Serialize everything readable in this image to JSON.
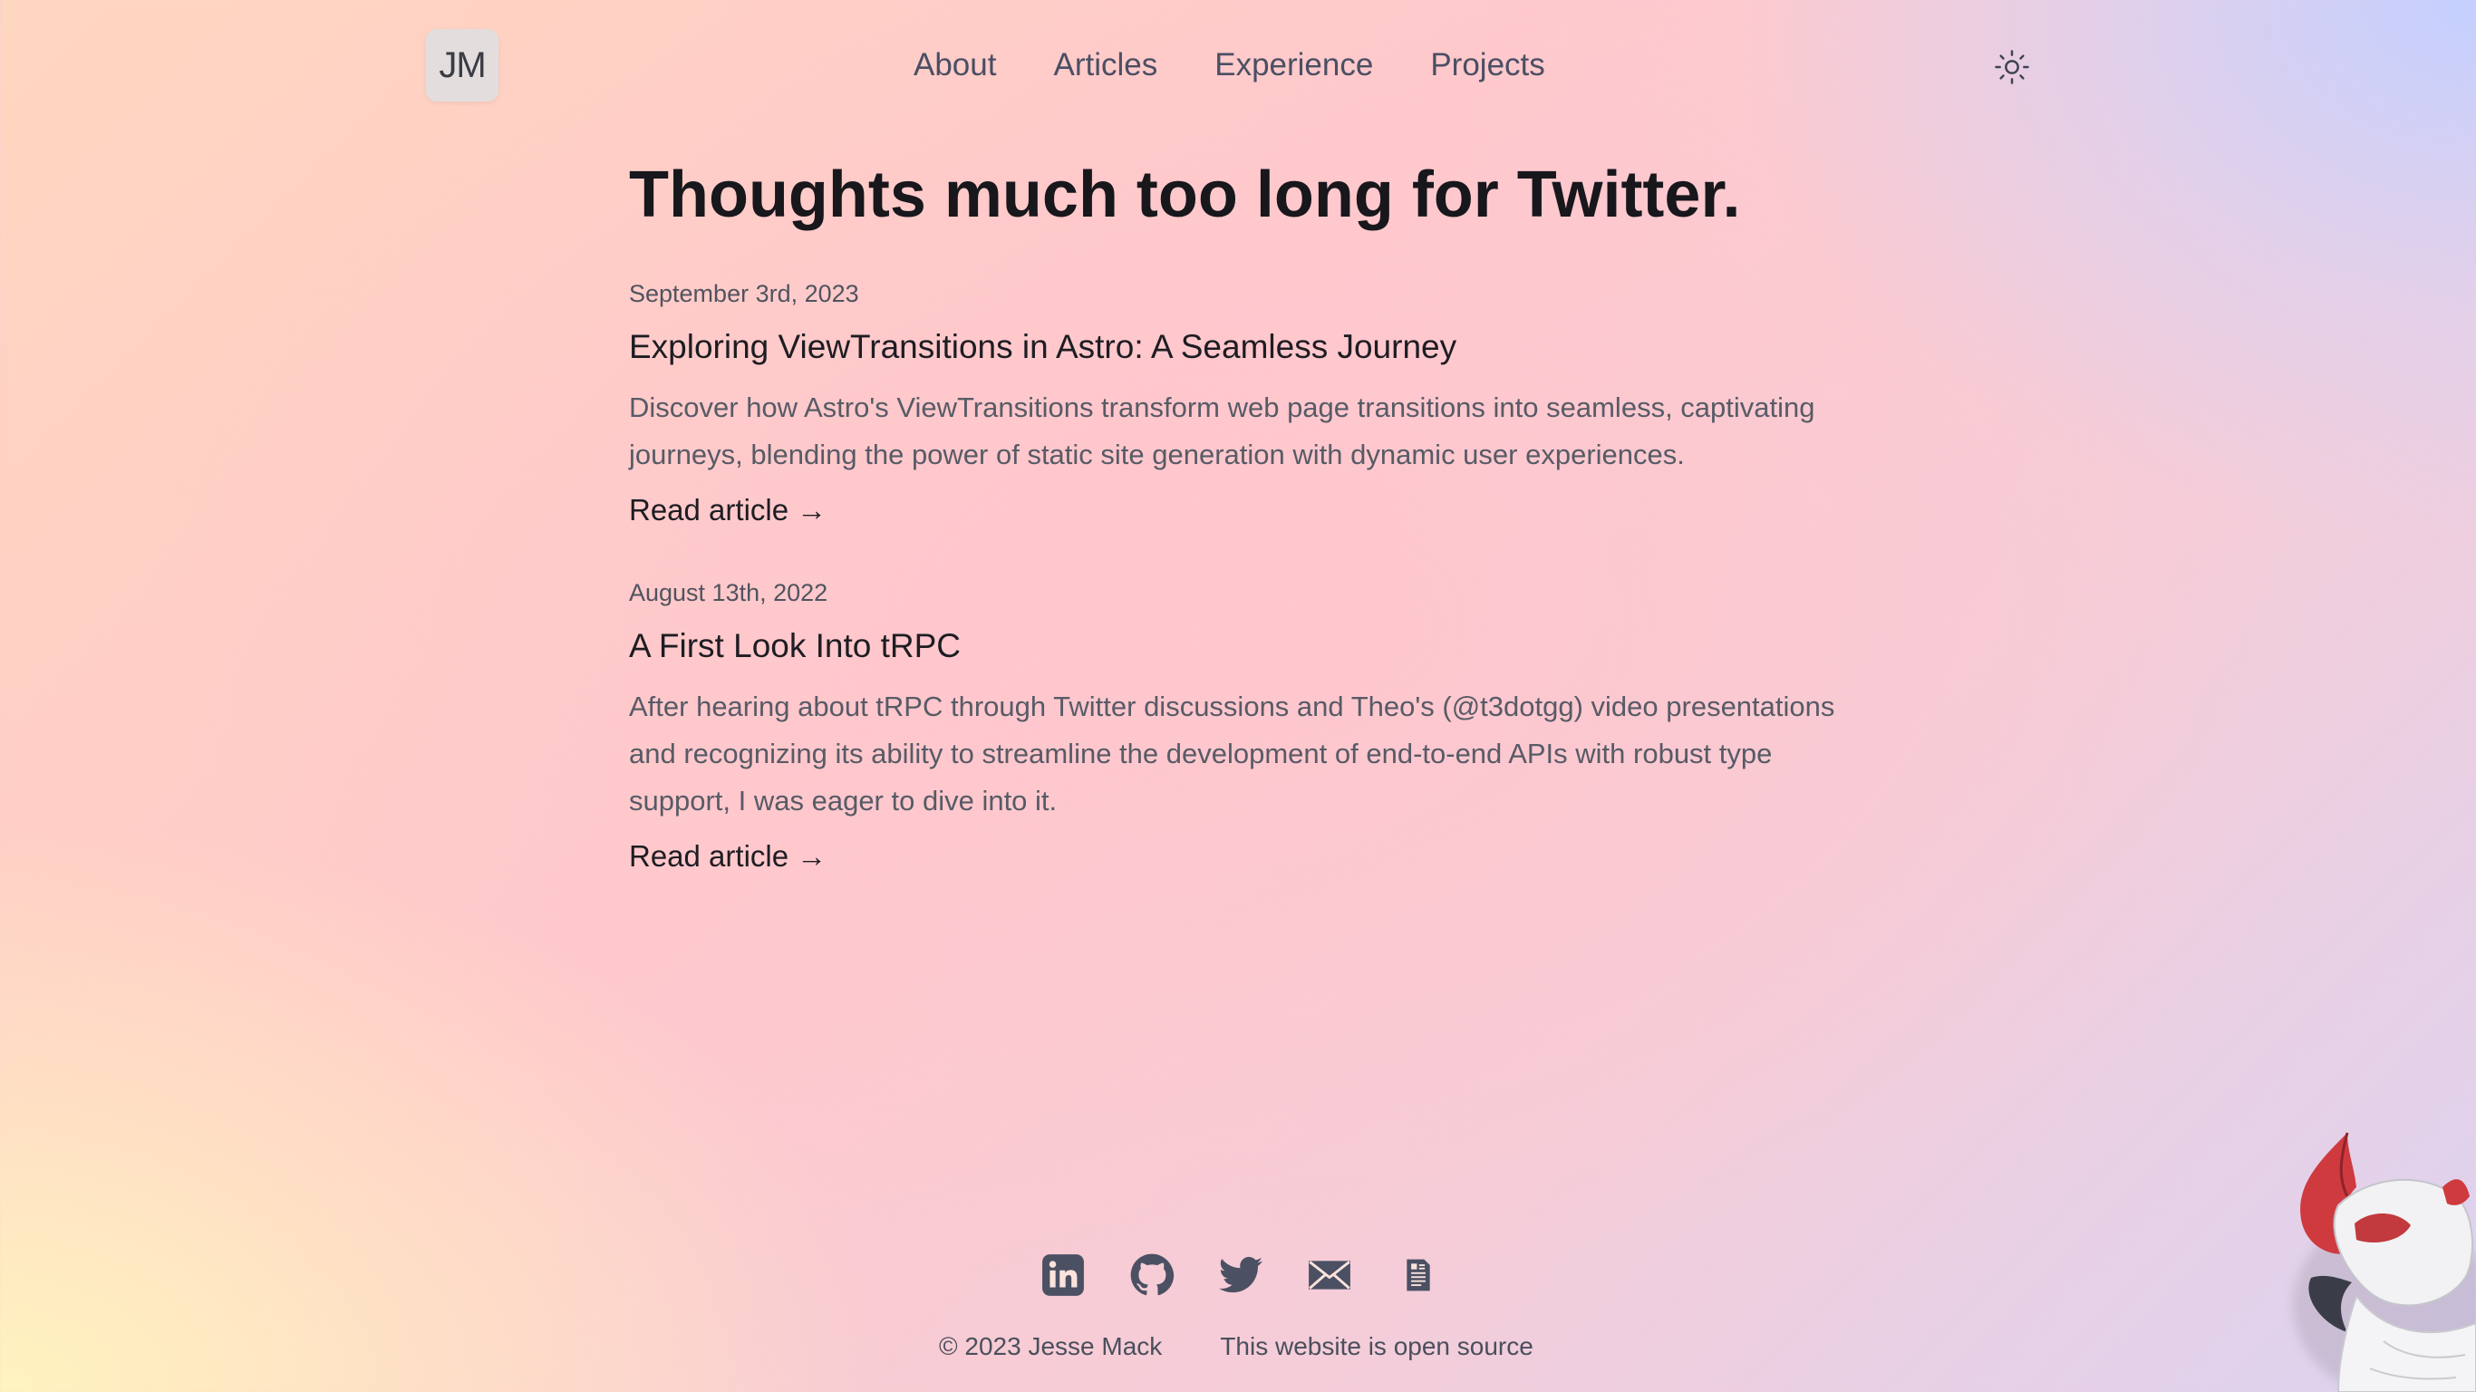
{
  "header": {
    "logo_text": "JM",
    "nav": [
      {
        "label": "About"
      },
      {
        "label": "Articles"
      },
      {
        "label": "Experience"
      },
      {
        "label": "Projects"
      }
    ],
    "theme_icon": "sun-icon"
  },
  "main": {
    "title": "Thoughts much too long for Twitter.",
    "articles": [
      {
        "date": "September 3rd, 2023",
        "title": "Exploring ViewTransitions in Astro: A Seamless Journey",
        "description": "Discover how Astro's ViewTransitions transform web page transitions into seamless, captivating journeys, blending the power of static site generation with dynamic user experiences.",
        "link_label": "Read article →"
      },
      {
        "date": "August 13th, 2022",
        "title": "A First Look Into tRPC",
        "description": "After hearing about tRPC through Twitter discussions and Theo's (@t3dotgg) video presentations and recognizing its ability to streamline the development of end-to-end APIs with robust type support, I was eager to dive into it.",
        "link_label": "Read article →"
      }
    ]
  },
  "footer": {
    "social_icons": [
      "linkedin-icon",
      "github-icon",
      "twitter-icon",
      "mail-icon",
      "resume-icon"
    ],
    "copyright": "© 2023 Jesse Mack",
    "source_link": "This website is open source"
  },
  "colors": {
    "text_primary": "#1d1d22",
    "text_secondary": "#575b66",
    "nav_text": "#4a4f63",
    "icon_color": "#4b5063"
  }
}
